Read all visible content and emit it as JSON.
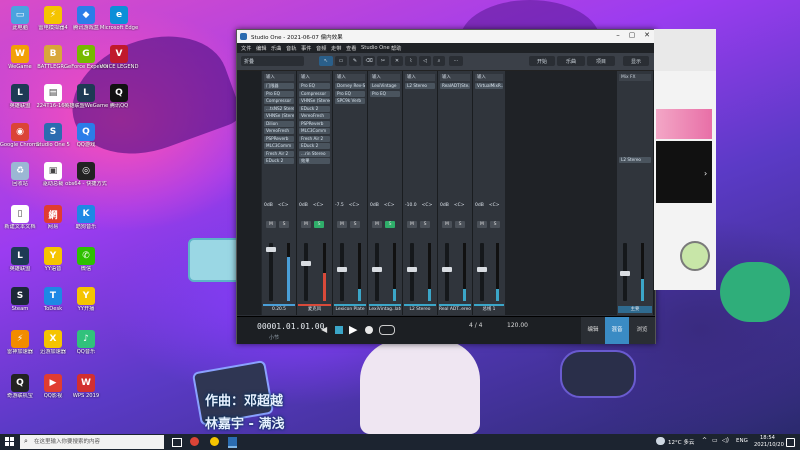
{
  "desktop": {
    "icons": [
      {
        "label": "此电脑",
        "color": "#4aa3df",
        "glyph": "▭"
      },
      {
        "label": "雷电模拟器4",
        "color": "#f5c400",
        "glyph": "⚡"
      },
      {
        "label": "腾讯游戏盒",
        "color": "#2b7de9",
        "glyph": "◆"
      },
      {
        "label": "Microsoft Edge",
        "color": "#0c8fd8",
        "glyph": "e"
      },
      {
        "label": "WeGame",
        "color": "#f2a007",
        "glyph": "W"
      },
      {
        "label": "BATTLEGR...",
        "color": "#d8a73a",
        "glyph": "B"
      },
      {
        "label": "GeForce Experience",
        "color": "#76b900",
        "glyph": "G"
      },
      {
        "label": "VOICE LEGEND",
        "color": "#c0192c",
        "glyph": "V"
      },
      {
        "label": "英雄联盟",
        "color": "#1e3a55",
        "glyph": "L"
      },
      {
        "label": "224T16-16...",
        "color": "#ffffff",
        "glyph": "▤"
      },
      {
        "label": "英雄联盟WeGame版",
        "color": "#1e3a55",
        "glyph": "L"
      },
      {
        "label": "腾讯QQ",
        "color": "#111111",
        "glyph": "Q"
      },
      {
        "label": "Google Chrome",
        "color": "#db4437",
        "glyph": "◉"
      },
      {
        "label": "Studio One 5",
        "color": "#2b6cb0",
        "glyph": "S"
      },
      {
        "label": "QQ游戏",
        "color": "#2b7de9",
        "glyph": "Q"
      },
      {
        "label": "回收站",
        "color": "#9bb7d4",
        "glyph": "♻"
      },
      {
        "label": "驱动总裁",
        "color": "#ffffff",
        "glyph": "▣"
      },
      {
        "label": "obs64 - 快捷方式",
        "color": "#222222",
        "glyph": "◎"
      },
      {
        "label": "新建文本文档",
        "color": "#ffffff",
        "glyph": "▯"
      },
      {
        "label": "网易",
        "color": "#e03c31",
        "glyph": "網"
      },
      {
        "label": "酷狗音乐",
        "color": "#1e88e5",
        "glyph": "K"
      },
      {
        "label": "英雄联盟",
        "color": "#1e3a55",
        "glyph": "L"
      },
      {
        "label": "YY语音",
        "color": "#f5c400",
        "glyph": "Y"
      },
      {
        "label": "微信",
        "color": "#2dc100",
        "glyph": "✆"
      },
      {
        "label": "Steam",
        "color": "#1b2838",
        "glyph": "S"
      },
      {
        "label": "ToDesk",
        "color": "#1e88e5",
        "glyph": "T"
      },
      {
        "label": "YY开播",
        "color": "#f5c400",
        "glyph": "Y"
      },
      {
        "label": "雷神加速器",
        "color": "#f28c00",
        "glyph": "⚡"
      },
      {
        "label": "迅游加速器",
        "color": "#f5c400",
        "glyph": "X"
      },
      {
        "label": "QQ音乐",
        "color": "#31c27c",
        "glyph": "♪"
      },
      {
        "label": "奇游联机宝",
        "color": "#222222",
        "glyph": "Q"
      },
      {
        "label": "QQ影视",
        "color": "#e03c31",
        "glyph": "▶"
      },
      {
        "label": "WPS 2019",
        "color": "#d32f2f",
        "glyph": "W"
      }
    ]
  },
  "studio_one": {
    "title": "Studio One - 2021-06-07 偏内效果",
    "menu": [
      "文件",
      "编辑",
      "乐曲",
      "音轨",
      "事件",
      "音频",
      "走带",
      "查看",
      "Studio One",
      "帮助"
    ],
    "toolbar": {
      "preset": "折叠",
      "start": "开始",
      "song": "乐曲",
      "project": "项目",
      "view": "显示"
    },
    "channels": [
      {
        "head": "输入",
        "inserts": [
          "门限器",
          "Pro EQ",
          "Compressor",
          "...tsNS2 Stereo",
          "VHNSe (Stereo)",
          "Dilion",
          "VereoFresh",
          "PSPReverb",
          "MLC3Comm",
          "Fresh Air 2",
          "EDuck 2"
        ],
        "vol": "0dB",
        "pan": "<C>",
        "name": "0.20.5",
        "accent": "#4a9fd8"
      },
      {
        "head": "输入",
        "inserts": [
          "Pro EQ",
          "Compressor",
          "VHNSe (Stereo)",
          "EDuck 2",
          "VereoFresh",
          "PSPReverb",
          "MLC3Comm",
          "Fresh Air 2",
          "EDuck 2",
          "...rin Stereo",
          "效果"
        ],
        "vol": "0dB",
        "pan": "<C>",
        "name": "麦克风",
        "accent": "#d94a3a"
      },
      {
        "head": "输入",
        "inserts": [
          "Dorney Rev-S",
          "Pro EQ",
          "SPC9k Verb"
        ],
        "vol": "-7.5",
        "pan": "<C>",
        "name": "Lexicon Plate",
        "accent": "#3ba6c8"
      },
      {
        "head": "输入",
        "inserts": [
          "LexiVintage",
          "Pro EQ"
        ],
        "vol": "0dB",
        "pan": "<C>",
        "name": "LexiVintag..late",
        "accent": "#3ba6c8"
      },
      {
        "head": "输入",
        "inserts": [
          "L2 Stereo"
        ],
        "vol": "-10.0",
        "pan": "<C>",
        "name": "L2 Stereo",
        "accent": "#3ba6c8"
      },
      {
        "head": "输入",
        "inserts": [
          "RealADT(Ste..."
        ],
        "vol": "0dB",
        "pan": "<C>",
        "name": "Real ADT..ereo",
        "accent": "#3ba6c8"
      },
      {
        "head": "输入",
        "inserts": [
          "VirtualMixR..."
        ],
        "vol": "0dB",
        "pan": "<C>",
        "name": "总线 1",
        "accent": "#3ba6c8"
      }
    ],
    "main_channel": {
      "head": "Mix FX",
      "ins": [
        "L2 Stereo"
      ],
      "name": "主要"
    },
    "transport": {
      "time": "00001.01.01.00",
      "bars": "小节",
      "signature": "4 / 4",
      "tempo": "120.00",
      "edit": "编辑",
      "mix": "混音",
      "browse": "浏览"
    }
  },
  "lyrics": {
    "line1": "作曲：邓超越",
    "line2": "林嘉宇 - 满浅"
  },
  "taskbar": {
    "search_placeholder": "在这里输入你要搜索的内容",
    "weather": "12°C 多云",
    "lang": "ENG",
    "time": "18:54",
    "date": "2021/10/20"
  }
}
